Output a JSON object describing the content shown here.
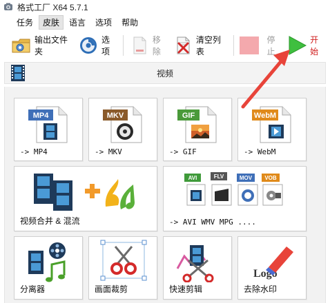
{
  "window": {
    "title": "格式工厂 X64 5.7.1"
  },
  "menu": {
    "items": [
      {
        "label": "任务",
        "active": false
      },
      {
        "label": "皮肤",
        "active": true
      },
      {
        "label": "语言",
        "active": false
      },
      {
        "label": "选项",
        "active": false
      },
      {
        "label": "帮助",
        "active": false
      }
    ]
  },
  "toolbar": {
    "output_folder": "输出文件夹",
    "options": "选项",
    "remove": "移除",
    "clear_list": "清空列表",
    "stop": "停止",
    "start": "开始"
  },
  "section": {
    "title": "视频"
  },
  "tiles": [
    {
      "label": "-> MP4",
      "badge": "MP4"
    },
    {
      "label": "-> MKV",
      "badge": "MKV"
    },
    {
      "label": "-> GIF",
      "badge": "GIF"
    },
    {
      "label": "-> WebM",
      "badge": "WebM"
    },
    {
      "label": "视频合并 & 混流"
    },
    {
      "label": "-> AVI WMV MPG ....",
      "badges": [
        "AVI",
        "FLV",
        "MOV",
        "VOB"
      ]
    },
    {
      "label": "分离器"
    },
    {
      "label": "画面裁剪"
    },
    {
      "label": "快速剪辑"
    },
    {
      "label": "去除水印",
      "logo_text": "Logo"
    }
  ],
  "colors": {
    "start_arrow": "#3fbf3f",
    "start_text": "#d02020",
    "annotation_arrow": "#e8443a",
    "badge_blue": "#3f6fb8",
    "badge_brown": "#8a5a2a",
    "badge_green": "#4a9a3a",
    "badge_orange": "#e08a1a"
  }
}
